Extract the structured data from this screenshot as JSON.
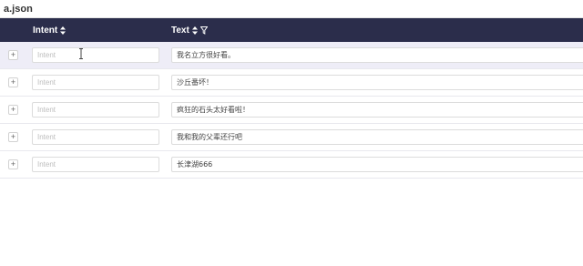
{
  "window": {
    "title": "a.json"
  },
  "header": {
    "intent_label": "Intent",
    "text_label": "Text",
    "intent_sort_icon": "sort-icon",
    "text_sort_icon": "sort-icon",
    "text_filter_icon": "filter-icon",
    "bg_color": "#2b2d4b"
  },
  "rows": [
    {
      "expand": "+",
      "intent_placeholder": "Intent",
      "text": "我名立方很好看。",
      "selected": true
    },
    {
      "expand": "+",
      "intent_placeholder": "Intent",
      "text": "沙丘番坏！",
      "selected": false
    },
    {
      "expand": "+",
      "intent_placeholder": "Intent",
      "text": "疯狂的石头太好看啦！",
      "selected": false
    },
    {
      "expand": "+",
      "intent_placeholder": "Intent",
      "text": "我和我的父辈还行吧",
      "selected": false
    },
    {
      "expand": "+",
      "intent_placeholder": "Intent",
      "text": "长津湖666",
      "selected": false
    }
  ]
}
